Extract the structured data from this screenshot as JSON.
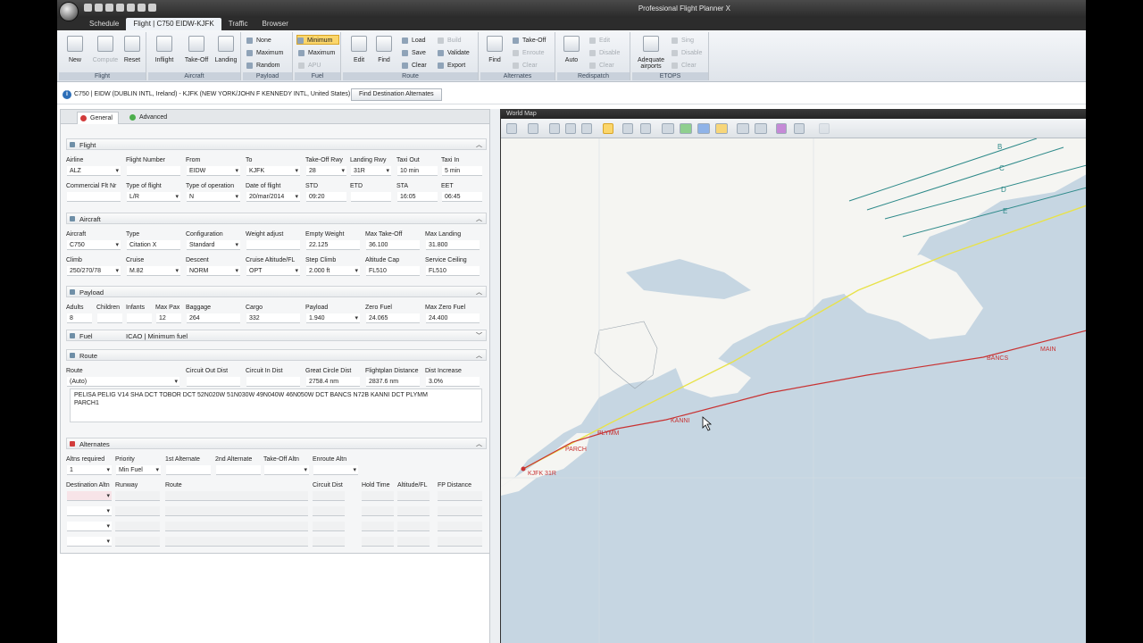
{
  "window": {
    "title": "Professional Flight Planner X"
  },
  "tabs": [
    "Schedule",
    "Flight | C750 EIDW-KJFK",
    "Traffic",
    "Browser"
  ],
  "ribbon": {
    "flight_group": {
      "label": "Flight",
      "new": "New",
      "compute": "Compute",
      "reset": "Reset"
    },
    "aircraft_group": {
      "label": "Aircraft",
      "inflight": "Inflight",
      "takeoff": "Take-Off",
      "landing": "Landing"
    },
    "payload_group": {
      "label": "Payload",
      "none": "None",
      "maximum": "Maximum",
      "random": "Random"
    },
    "fuel_group": {
      "label": "Fuel",
      "minimum": "Minimum",
      "maximum": "Maximum",
      "apu": "APU"
    },
    "route_group": {
      "label": "Route",
      "edit": "Edit",
      "find": "Find",
      "load": "Load",
      "save": "Save",
      "clear": "Clear",
      "build": "Build",
      "validate": "Validate",
      "export": "Export"
    },
    "alternates_group": {
      "label": "Alternates",
      "find": "Find",
      "takeoff": "Take-Off",
      "enroute": "Enroute",
      "clear": "Clear"
    },
    "redispatch_group": {
      "label": "Redispatch",
      "auto": "Auto",
      "edit": "Edit",
      "disable": "Disable",
      "clear": "Clear"
    },
    "etops_group": {
      "label": "ETOPS",
      "adequate": "Adequate airports",
      "sing": "Sing",
      "disable": "Disable",
      "clear": "Clear"
    }
  },
  "infobar": {
    "text": "C750 | EIDW (DUBLIN INTL, Ireland) - KJFK (NEW YORK/JOHN F KENNEDY INTL, United States)",
    "button": "Find Destination Alternates"
  },
  "panel_tabs": [
    "General",
    "Advanced"
  ],
  "flight": {
    "title": "Flight",
    "labels": [
      "Airline",
      "Flight Number",
      "From",
      "To",
      "Take-Off Rwy",
      "Landing Rwy",
      "Taxi Out",
      "Taxi In"
    ],
    "values": [
      "ALZ",
      "",
      "EIDW",
      "KJFK",
      "28",
      "31R",
      "10 min",
      "5 min"
    ],
    "labels2": [
      "Commercial Flt Nr",
      "Type of flight",
      "Type of operation",
      "Date of flight",
      "STD",
      "ETD",
      "STA",
      "EET"
    ],
    "values2": [
      "",
      "L/R",
      "N",
      "20/mar/2014",
      "09:20",
      "",
      "16:05",
      "06:45"
    ]
  },
  "aircraft": {
    "title": "Aircraft",
    "labels": [
      "Aircraft",
      "Type",
      "Configuration",
      "Weight adjust",
      "Empty Weight",
      "Max Take-Off",
      "Max Landing"
    ],
    "values": [
      "C750",
      "Citation X",
      "Standard",
      "",
      "22.125",
      "36.100",
      "31.800"
    ],
    "labels2": [
      "Climb",
      "Cruise",
      "Descent",
      "Cruise Altitude/FL",
      "Step Climb",
      "Altitude Cap",
      "Service Ceiling"
    ],
    "values2": [
      "250/270/78",
      "M.82",
      "NORM",
      "OPT",
      "2.000 ft",
      "FL510",
      "FL510"
    ]
  },
  "payload": {
    "title": "Payload",
    "labels": [
      "Adults",
      "Children",
      "Infants",
      "Max Pax",
      "Baggage",
      "Cargo",
      "Payload",
      "Zero Fuel",
      "Max Zero Fuel"
    ],
    "values": [
      "8",
      "",
      "",
      "12",
      "264",
      "332",
      "1.940",
      "24.065",
      "24.400"
    ]
  },
  "fuel": {
    "title": "Fuel",
    "summary": "ICAO | Minimum fuel"
  },
  "route": {
    "title": "Route",
    "labels": [
      "Route",
      "Circuit Out Dist",
      "Circuit In Dist",
      "Great Circle Dist",
      "Flightplan Distance",
      "Dist Increase"
    ],
    "values": [
      "(Auto)",
      "",
      "",
      "2758.4 nm",
      "2837.6 nm",
      "3.0%"
    ],
    "text_line1": "PELISA PELIG V14 SHA DCT TOBOR DCT 52N020W 51N030W 49N040W 46N050W DCT BANCS N72B KANNI DCT PLYMM",
    "text_line2": "PARCH1"
  },
  "alternates": {
    "title": "Alternates",
    "labels": [
      "Altns required",
      "Priority",
      "1st Alternate",
      "2nd Alternate",
      "Take-Off Altn",
      "Enroute Altn"
    ],
    "values": [
      "1",
      "Min Fuel",
      "",
      "",
      "",
      ""
    ],
    "table_headers": [
      "Destination Altn",
      "Runway",
      "Route",
      "Circuit Dist",
      "Hold Time",
      "Altitude/FL",
      "FP Distance"
    ]
  },
  "map": {
    "title": "World Map",
    "track_letters": [
      "B",
      "C",
      "D",
      "E"
    ],
    "waypoints": [
      "BANCS",
      "MAIN",
      "KANNI",
      "PLYMM",
      "KJFK 31R",
      "PARCH",
      "CCC"
    ]
  },
  "colors": {
    "accent_orange": "#fbd66b",
    "route_red": "#c83232",
    "route_yellow": "#e8e24a",
    "track_teal": "#2e8a8a",
    "sea": "#c6d6e2",
    "land": "#f5f5f2"
  }
}
